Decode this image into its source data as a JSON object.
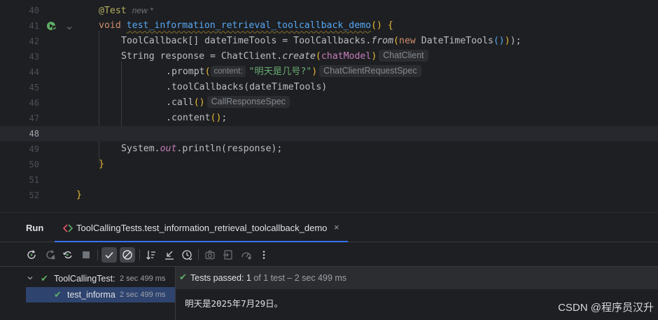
{
  "editor": {
    "lines": [
      {
        "no": "40"
      },
      {
        "no": "41"
      },
      {
        "no": "42"
      },
      {
        "no": "43"
      },
      {
        "no": "44"
      },
      {
        "no": "45"
      },
      {
        "no": "46"
      },
      {
        "no": "47"
      },
      {
        "no": "48"
      },
      {
        "no": "49"
      },
      {
        "no": "50"
      },
      {
        "no": "51"
      },
      {
        "no": "52"
      }
    ],
    "annotation": "@Test",
    "usage_hint": "new *",
    "kw_void": "void",
    "method_name": "test_information_retrieval_toolcallback_demo",
    "sig_tail": "() {",
    "l42_type": "ToolCallback[] dateTimeTools = ToolCallbacks.",
    "l42_from": "from",
    "l42_new": "new",
    "l42_ctor": " DateTimeTools",
    "l42_end": ");",
    "l43_start": "String response = ChatClient.",
    "l43_create": "create",
    "l43_param": "chatModel",
    "l43_hint": "ChatClient",
    "l44_call": ".prompt",
    "l44_param_hint": "content:",
    "l44_string": "\"明天是几号?\"",
    "l44_hint": "ChatClientRequestSpec",
    "l45_code": ".toolCallbacks(dateTimeTools)",
    "l46_call": ".call",
    "l46_hint": "CallResponseSpec",
    "l47_code": ".content",
    "l47_end": ";",
    "l49_a": "System.",
    "l49_out": "out",
    "l49_b": ".println(response);",
    "l50_code": "}",
    "l52_code": "}"
  },
  "run": {
    "title": "Run",
    "tab_label": "ToolCallingTests.test_information_retrieval_toolcallback_demo",
    "tab_close": "×",
    "tree": {
      "root_label": "ToolCallingTest:",
      "root_duration": "2 sec 499 ms",
      "child_label": "test_informa",
      "child_duration": "2 sec 499 ms"
    },
    "status": {
      "passed": "Tests passed: 1",
      "detail": "of 1 test – 2 sec 499 ms"
    },
    "output": "明天是2025年7月29日。"
  },
  "watermark": "CSDN @程序员汉升",
  "icons": {
    "gutter_run": "run-test-icon",
    "fold": "fold-chevron-icon",
    "toolbar": [
      "rerun-icon",
      "rerun-failed-icon",
      "toggle-auto-test-icon",
      "stop-icon",
      "show-passed-icon",
      "show-ignored-icon",
      "sort-icon",
      "collapse-icon",
      "history-icon",
      "export-icon",
      "import-icon",
      "coverage-icon",
      "more-icon"
    ]
  },
  "colors": {
    "background": "#1e1f22",
    "keyword": "#cf8e6d",
    "string": "#6aab73",
    "method": "#56a8f5",
    "success": "#5fad65",
    "accent": "#3574f0"
  }
}
